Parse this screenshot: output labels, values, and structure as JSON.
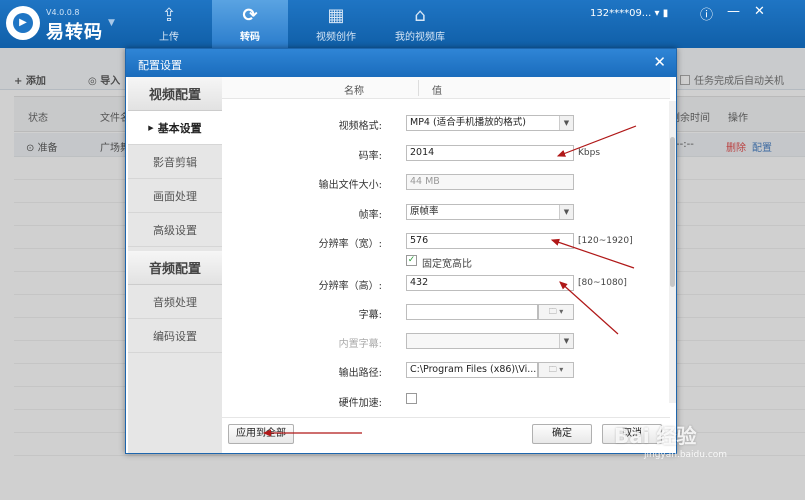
{
  "app": {
    "version": "V4.0.0.8",
    "name": "易转码",
    "logo_text": "▶"
  },
  "nav": [
    {
      "label": "上传",
      "icon": "upload-icon",
      "glyph": "⇪"
    },
    {
      "label": "转码",
      "icon": "convert-icon",
      "glyph": "⟳"
    },
    {
      "label": "视频创作",
      "icon": "film-icon",
      "glyph": "▦"
    },
    {
      "label": "我的视频库",
      "icon": "home-icon",
      "glyph": "⌂"
    }
  ],
  "user": {
    "account": "132****09..."
  },
  "toolbar": {
    "add_label": "+ 添加",
    "import_label": "◎ 导入",
    "auto_shutdown": "任务完成后自动关机"
  },
  "table": {
    "headers": [
      "状态",
      "文件名",
      "剩余时间",
      "操作"
    ],
    "rows": [
      {
        "status": "准备",
        "filename": "广场舞",
        "remaining": "--:--",
        "action_delete": "删除",
        "action_config": "配置"
      }
    ]
  },
  "dialog": {
    "title": "配置设置",
    "close": "✕",
    "sidebar": {
      "section_video": "视频配置",
      "video_items": [
        "基本设置",
        "影音剪辑",
        "画面处理",
        "高级设置"
      ],
      "section_audio": "音频配置",
      "audio_items": [
        "音频处理",
        "编码设置"
      ]
    },
    "columns": {
      "name": "名称",
      "value": "值"
    },
    "fields": {
      "format": {
        "label": "视频格式:",
        "value": "MP4 (适合手机播放的格式)"
      },
      "bitrate": {
        "label": "码率:",
        "value": "2014",
        "unit": "Kbps"
      },
      "filesize": {
        "label": "输出文件大小:",
        "value": "44 MB"
      },
      "framerate": {
        "label": "帧率:",
        "value": "原帧率"
      },
      "width": {
        "label": "分辨率（宽）:",
        "value": "576",
        "range": "[120~1920]"
      },
      "keep_ratio": {
        "label": "固定宽高比",
        "checked": true
      },
      "height": {
        "label": "分辨率（高）:",
        "value": "432",
        "range": "[80~1080]"
      },
      "subtitle": {
        "label": "字幕:",
        "value": ""
      },
      "embedded_subtitle": {
        "label": "内置字幕:",
        "value": ""
      },
      "output_path": {
        "label": "输出路径:",
        "value": "C:\\Program Files (x86)\\Vi..."
      },
      "hw_accel": {
        "label": "硬件加速:",
        "checked": false
      }
    },
    "buttons": {
      "apply_all": "应用到全部",
      "ok": "确定",
      "cancel": "取消"
    }
  },
  "watermark": {
    "text": "Bai 经验",
    "url": "jingyan.baidu.com"
  },
  "colors": {
    "titlebar": "#1f75c4",
    "annotation_red": "#b01818",
    "accent_red": "#d22"
  }
}
